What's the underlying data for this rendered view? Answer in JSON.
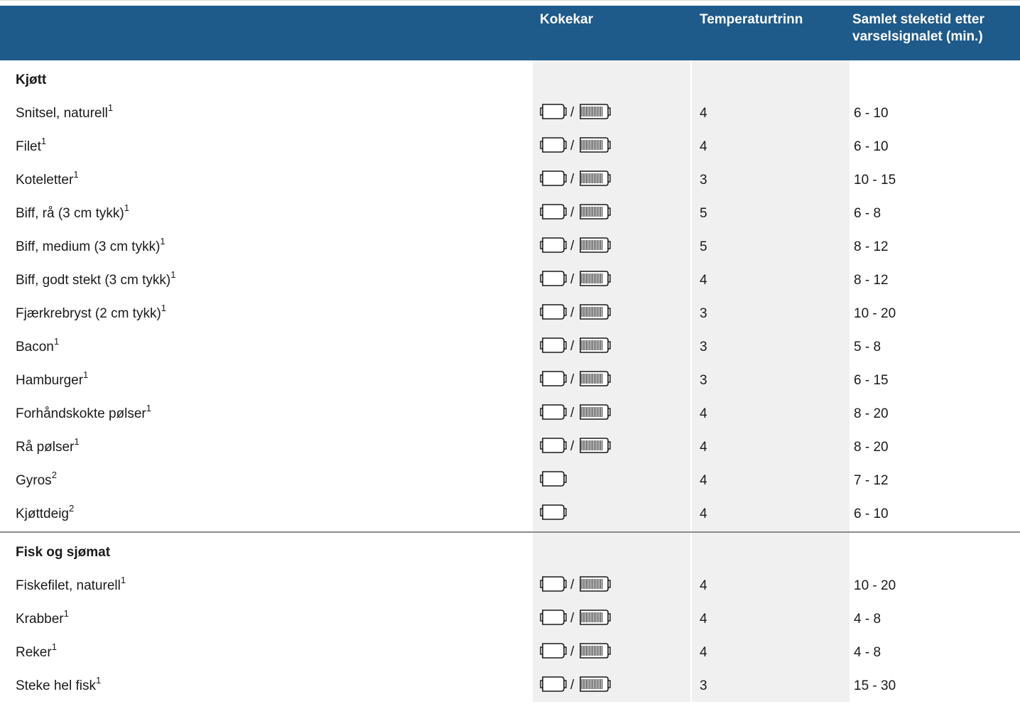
{
  "header": {
    "col_vessel": "Kokekar",
    "col_temp": "Temperaturtrinn",
    "col_time": "Samlet steketid etter varselsignalet (min.)"
  },
  "vessel_icons": {
    "pan": "frying-pan-icon",
    "grill": "grill-plate-icon"
  },
  "colors": {
    "header_bg": "#1e5a8a",
    "stripe": "#f0f0f0",
    "text": "#1a1a1a"
  },
  "sections": [
    {
      "title": "Kjøtt",
      "rows": [
        {
          "name": "Snitsel, naturell",
          "note": "1",
          "vessel": "both",
          "temp": "4",
          "time": "6 - 10"
        },
        {
          "name": "Filet",
          "note": "1",
          "vessel": "both",
          "temp": "4",
          "time": "6 - 10"
        },
        {
          "name": "Koteletter",
          "note": "1",
          "vessel": "both",
          "temp": "3",
          "time": "10 - 15"
        },
        {
          "name": "Biff, rå (3 cm tykk)",
          "note": "1",
          "vessel": "both",
          "temp": "5",
          "time": "6 - 8"
        },
        {
          "name": "Biff, medium (3 cm tykk)",
          "note": "1",
          "vessel": "both",
          "temp": "5",
          "time": "8 - 12"
        },
        {
          "name": "Biff, godt stekt (3 cm tykk)",
          "note": "1",
          "vessel": "both",
          "temp": "4",
          "time": "8 - 12"
        },
        {
          "name": "Fjærkrebryst (2 cm tykk)",
          "note": "1",
          "vessel": "both",
          "temp": "3",
          "time": "10 - 20"
        },
        {
          "name": "Bacon",
          "note": "1",
          "vessel": "both",
          "temp": "3",
          "time": "5 - 8"
        },
        {
          "name": "Hamburger",
          "note": "1",
          "vessel": "both",
          "temp": "3",
          "time": "6 - 15"
        },
        {
          "name": "Forhåndskokte pølser",
          "note": "1",
          "vessel": "both",
          "temp": "4",
          "time": "8 - 20"
        },
        {
          "name": "Rå pølser",
          "note": "1",
          "vessel": "both",
          "temp": "4",
          "time": "8 - 20"
        },
        {
          "name": "Gyros",
          "note": "2",
          "vessel": "pan",
          "temp": "4",
          "time": "7 - 12"
        },
        {
          "name": "Kjøttdeig",
          "note": "2",
          "vessel": "pan",
          "temp": "4",
          "time": "6 - 10"
        }
      ]
    },
    {
      "title": "Fisk og sjømat",
      "rows": [
        {
          "name": "Fiskefilet, naturell",
          "note": "1",
          "vessel": "both",
          "temp": "4",
          "time": "10 - 20"
        },
        {
          "name": "Krabber",
          "note": "1",
          "vessel": "both",
          "temp": "4",
          "time": "4 - 8"
        },
        {
          "name": "Reker",
          "note": "1",
          "vessel": "both",
          "temp": "4",
          "time": "4 - 8"
        },
        {
          "name": "Steke hel fisk",
          "note": "1",
          "vessel": "both",
          "temp": "3",
          "time": "15 - 30"
        }
      ]
    }
  ]
}
